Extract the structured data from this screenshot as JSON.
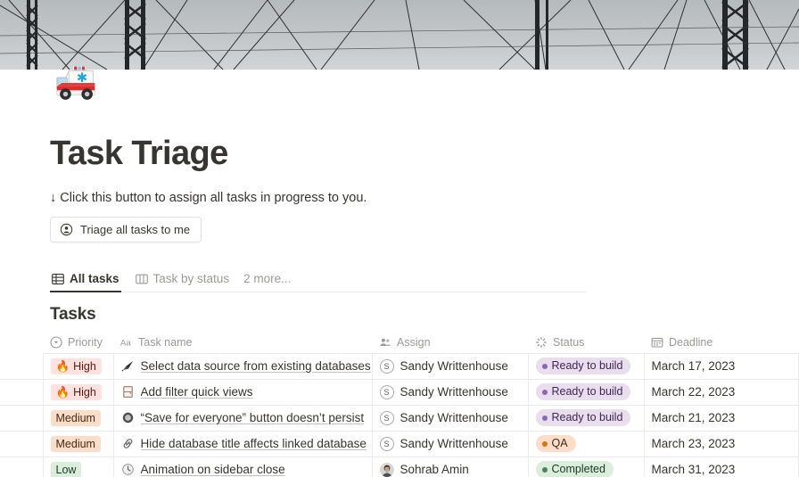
{
  "cover": {
    "alt": "electrical transmission towers against grey sky"
  },
  "page_icon": "ambulance-emoji",
  "header": {
    "title": "Task Triage",
    "callout": "↓ Click this button to assign all tasks in progress to you.",
    "button_label": "Triage all tasks to me",
    "button_icon": "person-circle-icon"
  },
  "tabs": {
    "items": [
      {
        "label": "All tasks",
        "icon": "table-grid-icon",
        "active": true
      },
      {
        "label": "Task by status",
        "icon": "board-columns-icon",
        "active": false
      }
    ],
    "more_label": "2 more..."
  },
  "table": {
    "section_title": "Tasks",
    "columns": [
      {
        "key": "priority",
        "label": "Priority",
        "icon": "select-chevron-circle-icon"
      },
      {
        "key": "name",
        "label": "Task name",
        "icon": "aa-text-icon"
      },
      {
        "key": "assign",
        "label": "Assign",
        "icon": "people-icon"
      },
      {
        "key": "status",
        "label": "Status",
        "icon": "status-spinner-icon"
      },
      {
        "key": "deadline",
        "label": "Deadline",
        "icon": "calendar-icon"
      }
    ],
    "rows": [
      {
        "priority": "High",
        "priority_style": "high",
        "priority_emoji": "fire-emoji",
        "name": "Select data source from existing databases",
        "name_icon": "dart-arrow-emoji",
        "assign": "Sandy Writtenhouse",
        "avatar": "letter-s",
        "status": "Ready to build",
        "status_style": "ready",
        "deadline": "March 17, 2023"
      },
      {
        "priority": "High",
        "priority_style": "high",
        "priority_emoji": "fire-emoji",
        "name": "Add filter quick views",
        "name_icon": "door-emoji",
        "assign": "Sandy Writtenhouse",
        "avatar": "letter-s",
        "status": "Ready to build",
        "status_style": "ready",
        "deadline": "March 22, 2023"
      },
      {
        "priority": "Medium",
        "priority_style": "medium",
        "priority_emoji": "",
        "name": "“Save for everyone” button doesn’t persist",
        "name_icon": "circle-button-emoji",
        "assign": "Sandy Writtenhouse",
        "avatar": "letter-s",
        "status": "Ready to build",
        "status_style": "ready",
        "deadline": "March 21, 2023"
      },
      {
        "priority": "Medium",
        "priority_style": "medium",
        "priority_emoji": "",
        "name": "Hide database title affects linked database",
        "name_icon": "paperclip-link-emoji",
        "assign": "Sandy Writtenhouse",
        "avatar": "letter-s",
        "status": "QA",
        "status_style": "qa",
        "deadline": "March 23, 2023"
      },
      {
        "priority": "Low",
        "priority_style": "low",
        "priority_emoji": "",
        "name": "Animation on sidebar close",
        "name_icon": "clock-emoji",
        "assign": "Sohrab Amin",
        "avatar": "photo",
        "status": "Completed",
        "status_style": "done",
        "deadline": "March 31, 2023"
      }
    ]
  },
  "colors": {
    "text": "#37352f",
    "muted": "#9b9a97",
    "border": "#ecebea",
    "high_bg": "#ffe2dd",
    "medium_bg": "#fadec9",
    "low_bg": "#dbeddb",
    "ready_bg": "#e8deee",
    "qa_bg": "#fadec9",
    "done_bg": "#dbeddb"
  }
}
